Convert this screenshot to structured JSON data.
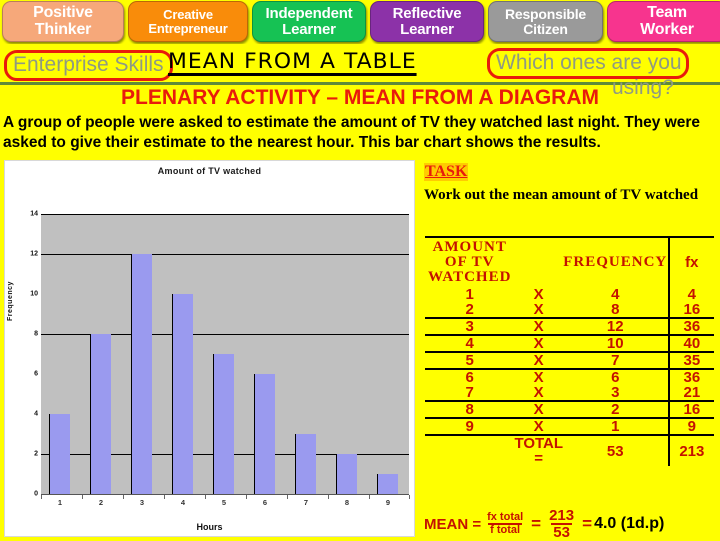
{
  "skills_bar": {
    "items": [
      {
        "label_line1": "Positive",
        "label_line2": "Thinker",
        "color": "#f6a87a"
      },
      {
        "label_line1": "Creative",
        "label_line2": "Entrepreneur",
        "color": "#f98c0a"
      },
      {
        "label_line1": "Independent",
        "label_line2": "Learner",
        "color": "#16c254"
      },
      {
        "label_line1": "Reflective",
        "label_line2": "Learner",
        "color": "#8c32a8"
      },
      {
        "label_line1": "Responsible",
        "label_line2": "Citizen",
        "color": "#9a9a9a"
      },
      {
        "label_line1": "Team",
        "label_line2": "Worker",
        "color": "#f7348e"
      }
    ]
  },
  "header": {
    "enterprise_skills": "Enterprise Skills",
    "topic_title": "MEAN FROM A TABLE",
    "which_line1": "Which ones are you",
    "which_line2": "using?",
    "plenary": "PLENARY ACTIVITY – MEAN FROM A DIAGRAM"
  },
  "intro": "A group of people were asked to estimate the amount of TV they watched last night. They were asked to give their estimate to the nearest hour. This bar chart shows the results.",
  "task": {
    "heading": "TASK",
    "body": "Work out the mean amount of TV watched"
  },
  "chart_data": {
    "type": "bar",
    "title": "Amount of TV watched",
    "xlabel": "Hours",
    "ylabel": "Frequency",
    "categories": [
      "1",
      "2",
      "3",
      "4",
      "5",
      "6",
      "7",
      "8",
      "9"
    ],
    "values": [
      4,
      8,
      12,
      10,
      7,
      6,
      3,
      2,
      1
    ],
    "ylim": [
      0,
      14
    ],
    "yticks": [
      "0",
      "2",
      "4",
      "6",
      "8",
      "10",
      "12",
      "14"
    ],
    "gridlines_at": [
      2,
      8,
      12,
      14
    ],
    "grid": true,
    "legend": "none",
    "bar_color": "#9a9aef",
    "plot_bg": "#c0c0c0"
  },
  "frequency_table": {
    "headers": {
      "amount": "AMOUNT OF TV WATCHED",
      "amount_l1": "AMOUNT",
      "amount_l2": "OF TV",
      "amount_l3": "WATCHED",
      "frequency": "FREQUENCY",
      "fx": "fx"
    },
    "multiply_symbol": "X",
    "rows": [
      {
        "amount": "1",
        "freq": "4",
        "fx": "4"
      },
      {
        "amount": "2",
        "freq": "8",
        "fx": "16"
      },
      {
        "amount": "3",
        "freq": "12",
        "fx": "36"
      },
      {
        "amount": "4",
        "freq": "10",
        "fx": "40"
      },
      {
        "amount": "5",
        "freq": "7",
        "fx": "35"
      },
      {
        "amount": "6",
        "freq": "6",
        "fx": "36"
      },
      {
        "amount": "7",
        "freq": "3",
        "fx": "21"
      },
      {
        "amount": "8",
        "freq": "2",
        "fx": "16"
      },
      {
        "amount": "9",
        "freq": "1",
        "fx": "9"
      }
    ],
    "total_label": "TOTAL =",
    "total_freq": "53",
    "total_fx": "213"
  },
  "mean_calc": {
    "label": "MEAN =",
    "frac1_num": "fx total",
    "frac1_den": "f total",
    "equals1": "=",
    "frac2_num": "213",
    "frac2_den": "53",
    "equals2": "=",
    "answer": "4.0 (1d.p)"
  }
}
